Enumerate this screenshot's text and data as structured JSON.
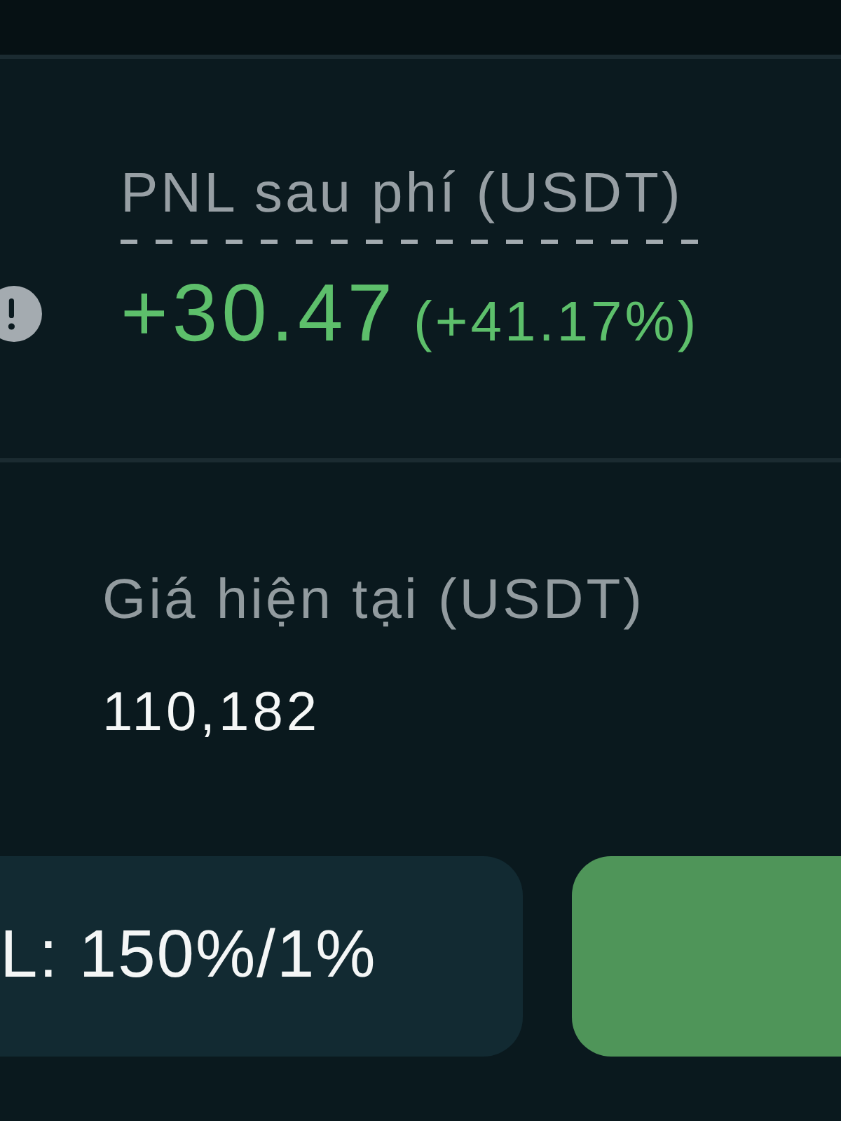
{
  "pnl_panel": {
    "label": "PNL sau phí (USDT)",
    "value": "+30.47",
    "percent": "(+41.17%)"
  },
  "price": {
    "label": "Giá hiện tại (USDT)",
    "value": "110,182"
  },
  "buttons": [
    {
      "kind": "secondary",
      "label": "L: 150%/1%"
    },
    {
      "kind": "primary"
    }
  ]
}
